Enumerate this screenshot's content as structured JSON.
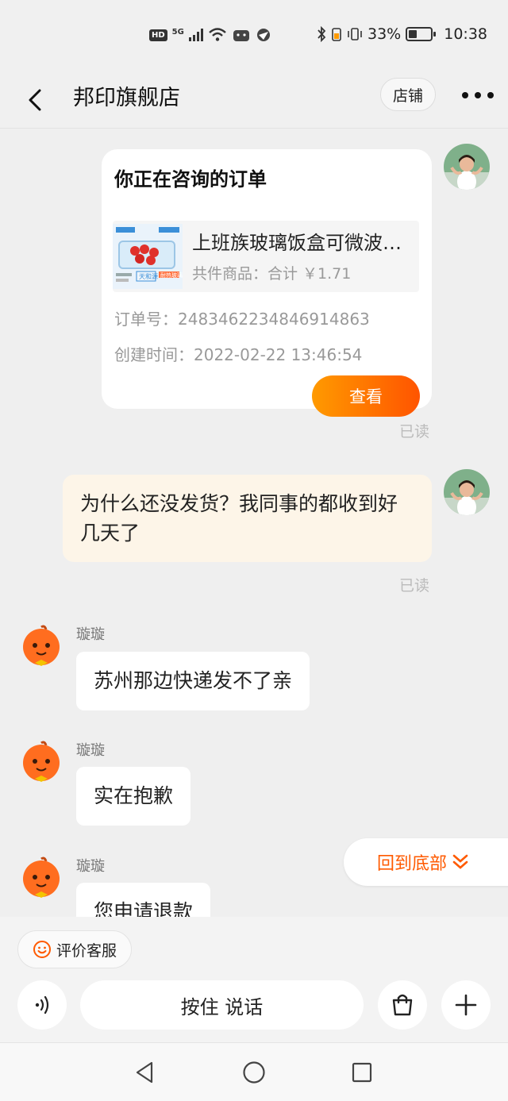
{
  "status_bar": {
    "network_hd": "HD",
    "network_5g": "5G",
    "battery_percent": "33%",
    "time": "10:38"
  },
  "header": {
    "title": "邦印旗舰店",
    "store_label": "店铺"
  },
  "order_card": {
    "heading": "你正在咨询的订单",
    "product_name": "上班族玻璃饭盒可微波炉加热",
    "summary": "共件商品：合计 ￥1.71",
    "order_number": "订单号：2483462234846914863",
    "created_time": "创建时间：2022-02-22 13:46:54",
    "view_label": "查看",
    "thumb_tag_left": "天和源",
    "thumb_tag_right": "耐热玻璃"
  },
  "messages": {
    "read_label": "已读",
    "mine_1": "为什么还没发货？我同事的都收到好几天了",
    "bot_name": "璇璇",
    "bot_1": "苏州那边快递发不了亲",
    "bot_2": "实在抱歉",
    "bot_3": "您申请退款"
  },
  "scroll_to_bottom_label": "回到底部",
  "input_bar": {
    "rate_service_label": "评价客服",
    "hold_to_talk_label": "按住 说话"
  },
  "colors": {
    "accent": "#ff5a00",
    "accent_gradient_start": "#ff9a00",
    "mine_bubble": "#fdf5e8",
    "background": "#efefef"
  },
  "icons": [
    "back-icon",
    "more-icon",
    "voice-icon",
    "bag-icon",
    "plus-icon",
    "smile-icon",
    "chevron-down-double-icon",
    "nav-back-icon",
    "nav-home-icon",
    "nav-recent-icon"
  ]
}
